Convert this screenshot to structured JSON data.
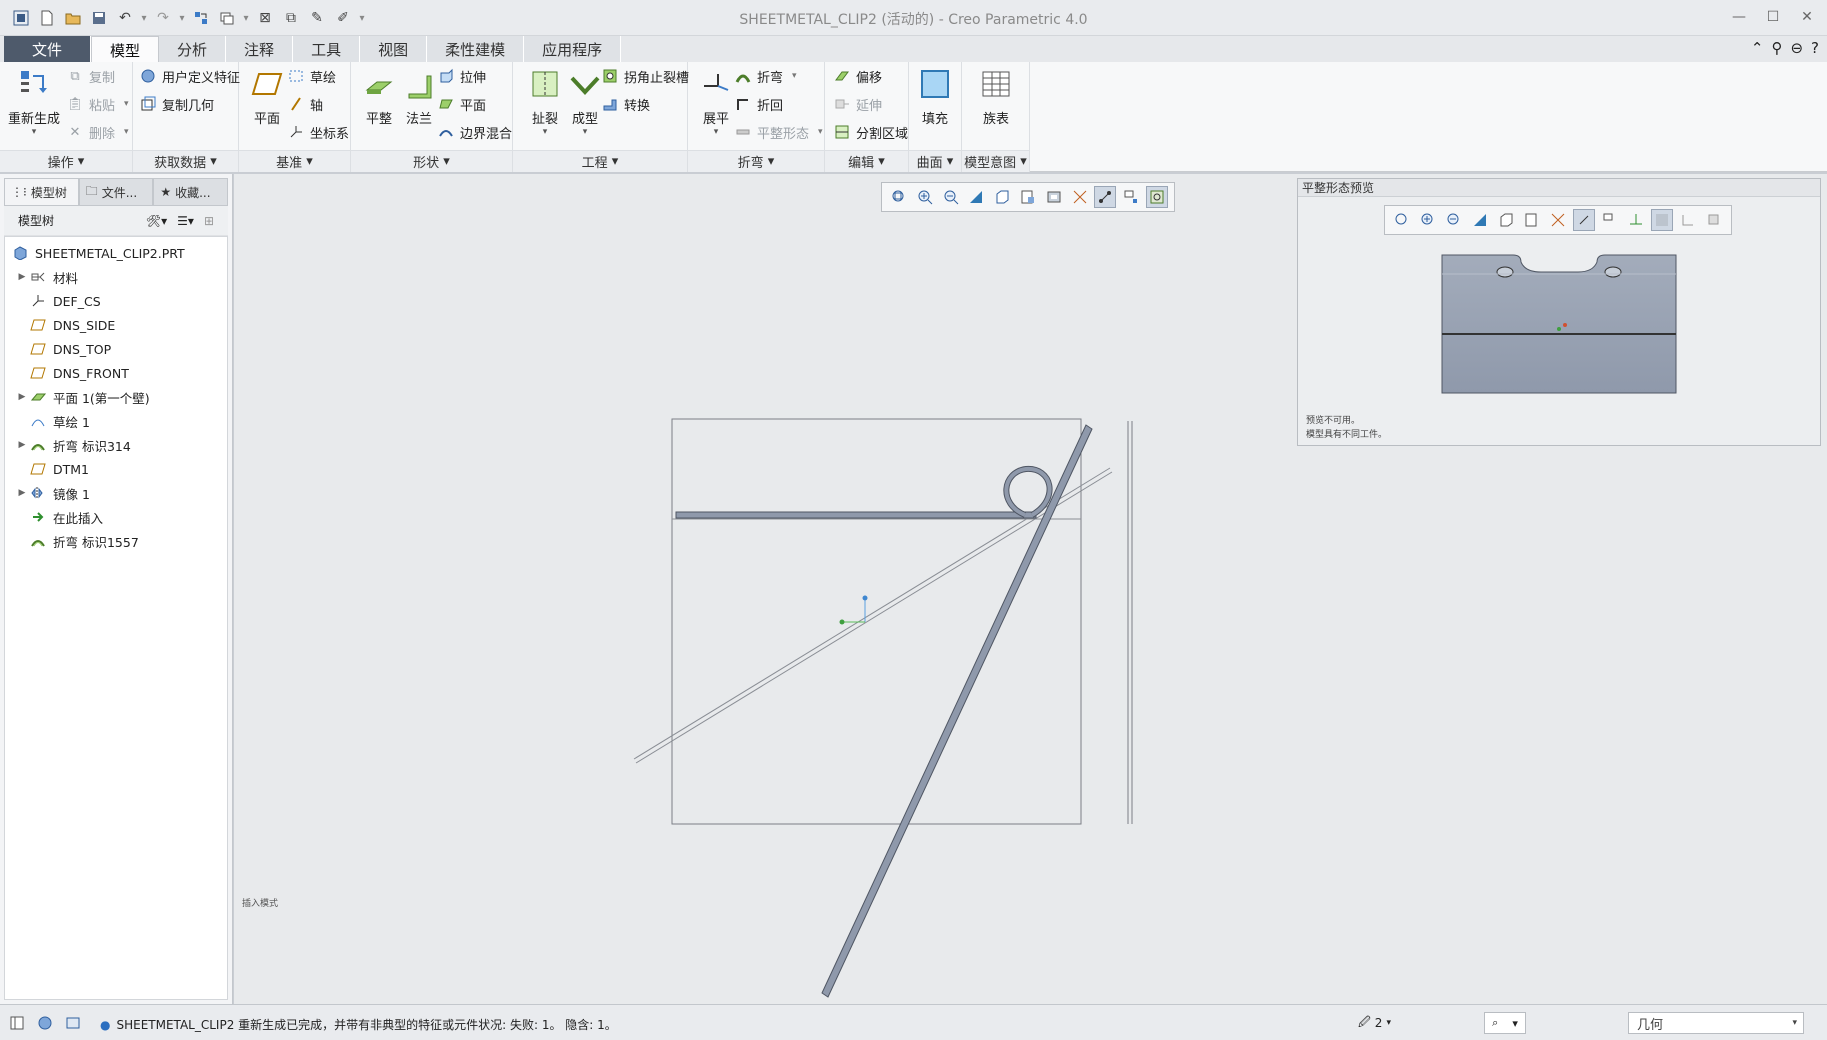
{
  "window": {
    "title": "SHEETMETAL_CLIP2 (活动的) - Creo Parametric 4.0",
    "controls": [
      "—",
      "☐",
      "✕"
    ]
  },
  "ribbon_tabs": [
    {
      "label": "文件",
      "kind": "file"
    },
    {
      "label": "模型",
      "kind": "active"
    },
    {
      "label": "分析",
      "kind": ""
    },
    {
      "label": "注释",
      "kind": ""
    },
    {
      "label": "工具",
      "kind": ""
    },
    {
      "label": "视图",
      "kind": ""
    },
    {
      "label": "柔性建模",
      "kind": ""
    },
    {
      "label": "应用程序",
      "kind": ""
    }
  ],
  "ribbon": {
    "operations": {
      "label": "操作",
      "regenerate": "重新生成",
      "copy": "复制",
      "paste": "粘贴",
      "delete": "删除"
    },
    "get_data": {
      "label": "获取数据",
      "udf": "用户定义特征",
      "copy_geom": "复制几何"
    },
    "datum": {
      "label": "基准",
      "plane": "平面",
      "sketch": "草绘",
      "axis": "轴",
      "csys": "坐标系"
    },
    "shapes": {
      "label": "形状",
      "planar": "平整",
      "flange": "法兰",
      "extrude": "拉伸",
      "plane": "平面",
      "boundary": "边界混合"
    },
    "engineering": {
      "label": "工程",
      "rip": "扯裂",
      "form": "成型",
      "corner_relief": "拐角止裂槽",
      "convert": "转换"
    },
    "bends": {
      "label": "折弯",
      "unbend": "展平",
      "bend": "折弯",
      "bend_back": "折回",
      "flat_state": "平整形态"
    },
    "editing": {
      "label": "编辑",
      "offset": "偏移",
      "extend": "延伸",
      "split": "分割区域"
    },
    "surfaces": {
      "label": "曲面",
      "fill": "填充"
    },
    "intent": {
      "label": "模型意图",
      "family": "族表"
    }
  },
  "left_panel": {
    "tabs": [
      "模型树",
      "文件...",
      "收藏..."
    ],
    "toolbar_label": "模型树",
    "tree": [
      {
        "label": "SHEETMETAL_CLIP2.PRT",
        "expand": "",
        "icon": "part-icon",
        "level": 0
      },
      {
        "label": "材料",
        "expand": "▶",
        "icon": "material-icon",
        "level": 1
      },
      {
        "label": "DEF_CS",
        "expand": "",
        "icon": "csys-icon",
        "level": 1
      },
      {
        "label": "DNS_SIDE",
        "expand": "",
        "icon": "datum-plane-icon",
        "level": 1
      },
      {
        "label": "DNS_TOP",
        "expand": "",
        "icon": "datum-plane-icon",
        "level": 1
      },
      {
        "label": "DNS_FRONT",
        "expand": "",
        "icon": "datum-plane-icon",
        "level": 1
      },
      {
        "label": "平面 1(第一个壁)",
        "expand": "▶",
        "icon": "planar-wall-icon",
        "level": 1
      },
      {
        "label": "草绘 1",
        "expand": "",
        "icon": "sketch-icon",
        "level": 1
      },
      {
        "label": "折弯 标识314",
        "expand": "▶",
        "icon": "bend-icon",
        "level": 1
      },
      {
        "label": "DTM1",
        "expand": "",
        "icon": "datum-plane-icon",
        "level": 1
      },
      {
        "label": "镜像 1",
        "expand": "▶",
        "icon": "mirror-icon",
        "level": 1
      },
      {
        "label": "在此插入",
        "expand": "",
        "icon": "insert-here-icon",
        "level": 1
      },
      {
        "label": "折弯 标识1557",
        "expand": "",
        "icon": "bend-icon",
        "level": 1
      }
    ]
  },
  "graphics": {
    "mode_label": "插入模式"
  },
  "preview": {
    "title": "平整形态预览",
    "msg1": "预览不可用。",
    "msg2": "模型具有不同工件。"
  },
  "status": {
    "message": "SHEETMETAL_CLIP2 重新生成已完成，并带有非典型的特征或元件状况: 失败: 1。 隐含: 1。",
    "selection_count": "2",
    "filter": "几何"
  },
  "colors": {
    "file_tab": "#4e5a6b",
    "sheet_metal": "#8f99ab",
    "graphics_bg": "#e8eaec"
  }
}
